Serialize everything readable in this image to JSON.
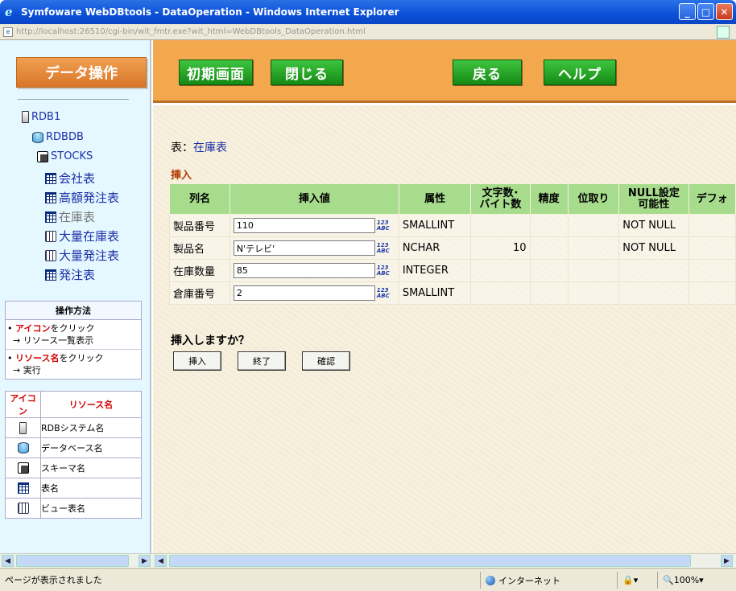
{
  "window": {
    "title": "Symfoware WebDBtools - DataOperation - Windows Internet Explorer",
    "url_host": "localhost",
    "url": "http://localhost:26510/cgi-bin/wit_fmtr.exe?wit_html=WebDBtools_DataOperation.html"
  },
  "sidebar": {
    "header": "データ操作",
    "tree": {
      "rdb": "RDB1",
      "db": "RDBDB",
      "schema": "STOCKS",
      "tables": [
        {
          "label": "会社表",
          "icon": "table-icon"
        },
        {
          "label": "高額発注表",
          "icon": "table-icon"
        },
        {
          "label": "在庫表",
          "icon": "table-icon"
        },
        {
          "label": "大量在庫表",
          "icon": "view-icon"
        },
        {
          "label": "大量発注表",
          "icon": "view-icon"
        },
        {
          "label": "発注表",
          "icon": "table-icon"
        }
      ]
    },
    "howto": {
      "title": "操作方法",
      "item1_highlight": "アイコン",
      "item1_text": "をクリック",
      "item1_line2": "→ リソース一覧表示",
      "item2_highlight": "リソース名",
      "item2_text": "をクリック",
      "item2_line2": "→ 実行"
    },
    "legend": {
      "col_icon": "アイコン",
      "col_name": "リソース名",
      "rows": [
        "RDBシステム名",
        "データベース名",
        "スキーマ名",
        "表名",
        "ビュー表名"
      ]
    }
  },
  "toolbar": {
    "initial": "初期画面",
    "close": "閉じる",
    "back": "戻る",
    "help": "ヘルプ"
  },
  "main": {
    "table_label": "表：",
    "table_name": "在庫表",
    "section": "挿入",
    "headers": {
      "colname": "列名",
      "value": "挿入値",
      "type": "属性",
      "len1": "文字数･",
      "len2": "バイト数",
      "precision": "精度",
      "scale": "位取り",
      "null1": "NULL設定",
      "null2": "可能性",
      "default": "デフォ"
    },
    "rows": [
      {
        "name": "製品番号",
        "value": "110",
        "type": "SMALLINT",
        "length": "",
        "null": "NOT NULL"
      },
      {
        "name": "製品名",
        "value": "N'テレビ'",
        "type": "NCHAR",
        "length": "10",
        "null": "NOT NULL"
      },
      {
        "name": "在庫数量",
        "value": "85",
        "type": "INTEGER",
        "length": "",
        "null": ""
      },
      {
        "name": "倉庫番号",
        "value": "2",
        "type": "SMALLINT",
        "length": "",
        "null": ""
      }
    ],
    "abc_top": "123",
    "abc_bottom": "ABC",
    "question": "挿入しますか？",
    "buttons": {
      "insert": "挿入",
      "end": "終了",
      "confirm": "確認"
    }
  },
  "statusbar": {
    "text": "ページが表示されました",
    "zone": "インターネット",
    "zoom": "100%"
  }
}
